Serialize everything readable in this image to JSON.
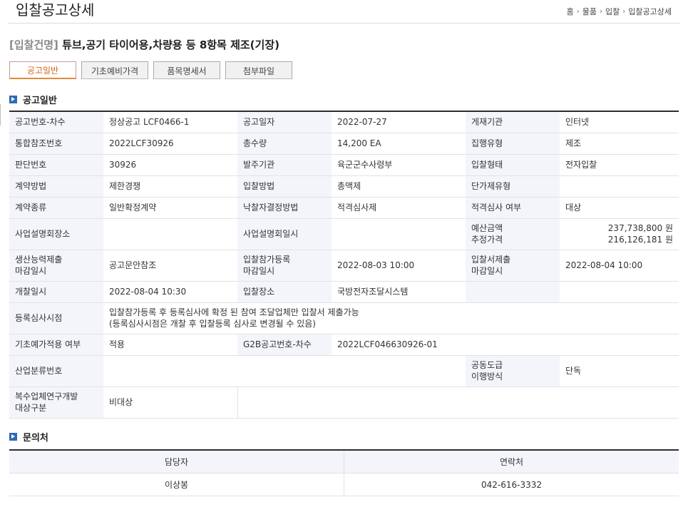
{
  "header": {
    "title": "입찰공고상세",
    "breadcrumb": [
      "홈",
      "물품",
      "입찰",
      "입찰공고상세"
    ]
  },
  "headline": {
    "tag": "[입찰건명]",
    "title": "튜브,공기 타이어용,차량용 등 8항목 제조(기장)"
  },
  "tabs": [
    "공고일반",
    "기초예비가격",
    "품목명세서",
    "첨부파일"
  ],
  "sections": {
    "general": "공고일반",
    "contact": "문의처"
  },
  "general": {
    "r1": {
      "k1": "공고번호-차수",
      "v1": "정상공고 LCF0466-1",
      "k2": "공고일자",
      "v2": "2022-07-27",
      "k3": "게재기관",
      "v3": "인터넷"
    },
    "r2": {
      "k1": "통합참조번호",
      "v1": "2022LCF30926",
      "k2": "총수량",
      "v2": "14,200 EA",
      "k3": "집행유형",
      "v3": "제조"
    },
    "r3": {
      "k1": "판단번호",
      "v1": "30926",
      "k2": "발주기관",
      "v2": "육군군수사령부",
      "k3": "입찰형태",
      "v3": "전자입찰"
    },
    "r4": {
      "k1": "계약방법",
      "v1": "제한경쟁",
      "k2": "입찰방법",
      "v2": "총액제",
      "k3": "단가제유형",
      "v3": ""
    },
    "r5": {
      "k1": "계약종류",
      "v1": "일반확정계약",
      "k2": "낙찰자결정방법",
      "v2": "적격심사제",
      "k3": "적격심사 여부",
      "v3": "대상"
    },
    "r6": {
      "k1": "사업설명회장소",
      "v1": "",
      "k2": "사업설명회일시",
      "v2": "",
      "k3a": "예산금액",
      "k3b": "추정가격",
      "v3a": "237,738,800 원",
      "v3b": "216,126,181 원"
    },
    "r7": {
      "k1a": "생산능력제출",
      "k1b": "마감일시",
      "v1": "공고문안참조",
      "k2a": "입찰참가등록",
      "k2b": "마감일시",
      "v2": "2022-08-03 10:00",
      "k3a": "입찰서제출",
      "k3b": "마감일시",
      "v3": "2022-08-04 10:00"
    },
    "r8": {
      "k1": "개찰일시",
      "v1": "2022-08-04 10:30",
      "k2": "입찰장소",
      "v2": "국방전자조달시스템",
      "k3": "",
      "v3": ""
    },
    "r9": {
      "k1": "등록심사시점",
      "v1a": "입찰참가등록 후 등록심사에 확정 된 참여 조달업체만 입찰서 제출가능",
      "v1b": "(등록심사시점은 개찰 후 입찰등록 심사로 변경될 수 있음)"
    },
    "r10": {
      "k1": "기초예가적용 여부",
      "v1": "적용",
      "k2": "G2B공고번호-차수",
      "v2": "2022LCF046630926-01"
    },
    "r11": {
      "k1": "산업분류번호",
      "v1": "",
      "k3a": "공동도급",
      "k3b": "이행방식",
      "v3": "단독"
    },
    "r12": {
      "k1a": "복수업체연구개발",
      "k1b": "대상구분",
      "v1": "비대상"
    }
  },
  "contact": {
    "headers": [
      "담당자",
      "연락처"
    ],
    "rows": [
      [
        "이상봉",
        "042-616-3332"
      ]
    ]
  },
  "colors": {
    "accent": "#d9651c",
    "sectionIcon": "#2d6bb5",
    "headerCell": "#f3f5fb"
  }
}
